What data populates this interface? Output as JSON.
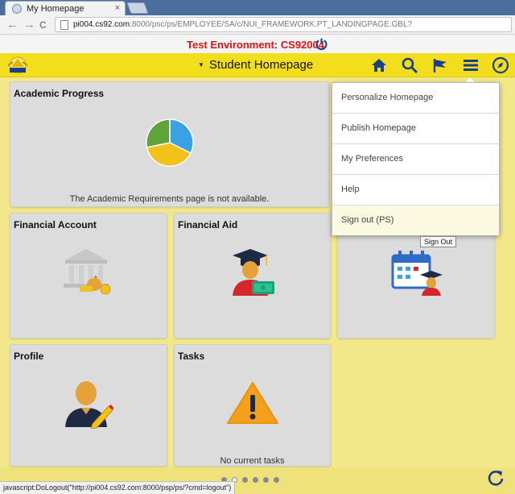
{
  "browser": {
    "tab_title": "My Homepage",
    "tab_close": "×",
    "back": "←",
    "forward": "→",
    "reload": "C",
    "url_host": "pi004.cs92.com",
    "url_path": ":8000/psc/ps/EMPLOYEE/SA/c/NUI_FRAMEWORK.PT_LANDINGPAGE.GBL?"
  },
  "environment": {
    "label": "Test Environment: CS92004",
    "color": "#e01414"
  },
  "header": {
    "title": "Student Homepage",
    "caret": "▼",
    "accent": "#1b3f8b",
    "background": "#f3de1e",
    "icons": [
      "home-icon",
      "search-icon",
      "flag-icon",
      "menu-icon",
      "compass-icon"
    ]
  },
  "tiles": {
    "academic_progress": {
      "title": "Academic Progress",
      "message": "The Academic Requirements page is not available."
    },
    "financial_account": {
      "title": "Financial Account"
    },
    "financial_aid": {
      "title": "Financial Aid"
    },
    "profile": {
      "title": "Profile"
    },
    "tasks": {
      "title": "Tasks",
      "message": "No current tasks"
    }
  },
  "menu": {
    "items": [
      "Personalize Homepage",
      "Publish Homepage",
      "My Preferences",
      "Help",
      "Sign out (PS)"
    ],
    "tooltip": "Sign Out"
  },
  "footer": {
    "page_count": 6,
    "active_page": 1
  },
  "status": {
    "text": "javascript:DoLogout(\"http://pi004.cs92.com:8000/psp/ps/?cmd=logout\")"
  }
}
